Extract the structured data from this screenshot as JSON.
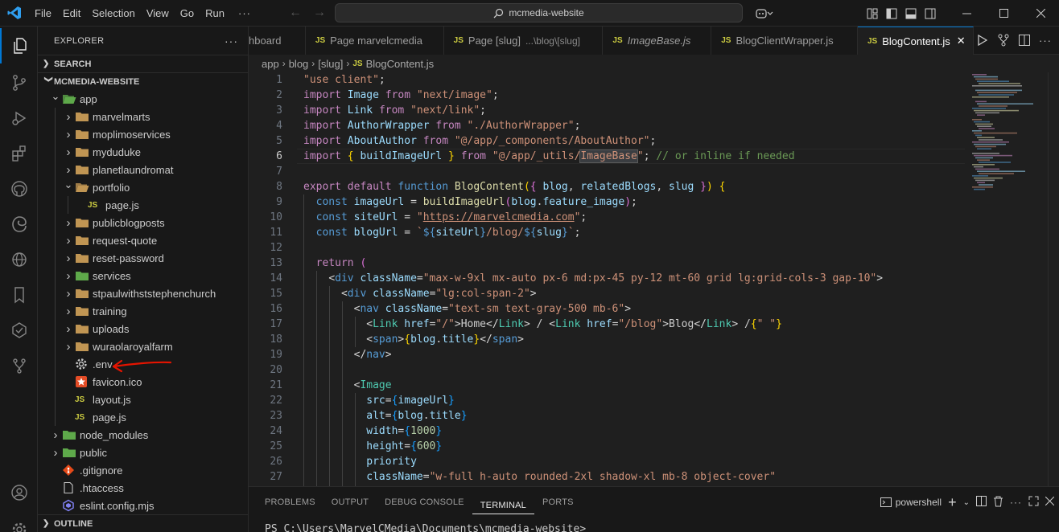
{
  "titlebar": {
    "menu": [
      "File",
      "Edit",
      "Selection",
      "View",
      "Go",
      "Run",
      "···"
    ],
    "search_text": "mcmedia-website"
  },
  "sidebar": {
    "header": "EXPLORER",
    "header_more": "···",
    "search_section": "SEARCH",
    "project_section": "MCMEDIA-WEBSITE",
    "outline_section": "OUTLINE",
    "tree": [
      {
        "label": "app",
        "kind": "folder-special",
        "depth": 1,
        "open": true
      },
      {
        "label": "marvelmarts",
        "kind": "folder",
        "depth": 2
      },
      {
        "label": "moplimoservices",
        "kind": "folder",
        "depth": 2
      },
      {
        "label": "myduduke",
        "kind": "folder",
        "depth": 2
      },
      {
        "label": "planetlaundromat",
        "kind": "folder",
        "depth": 2
      },
      {
        "label": "portfolio",
        "kind": "folder",
        "depth": 2,
        "open": true
      },
      {
        "label": "page.js",
        "kind": "js",
        "depth": 3
      },
      {
        "label": "publicblogposts",
        "kind": "folder",
        "depth": 2
      },
      {
        "label": "request-quote",
        "kind": "folder",
        "depth": 2
      },
      {
        "label": "reset-password",
        "kind": "folder",
        "depth": 2
      },
      {
        "label": "services",
        "kind": "folder-special",
        "depth": 2
      },
      {
        "label": "stpaulwithststephenchurch",
        "kind": "folder",
        "depth": 2
      },
      {
        "label": "training",
        "kind": "folder",
        "depth": 2
      },
      {
        "label": "uploads",
        "kind": "folder",
        "depth": 2
      },
      {
        "label": "wuraolaroyalfarm",
        "kind": "folder",
        "depth": 2
      },
      {
        "label": ".env",
        "kind": "gear",
        "depth": 2
      },
      {
        "label": "favicon.ico",
        "kind": "star",
        "depth": 2
      },
      {
        "label": "layout.js",
        "kind": "js",
        "depth": 2
      },
      {
        "label": "page.js",
        "kind": "js",
        "depth": 2
      },
      {
        "label": "node_modules",
        "kind": "folder-special",
        "depth": 1
      },
      {
        "label": "public",
        "kind": "folder-special",
        "depth": 1
      },
      {
        "label": ".gitignore",
        "kind": "git",
        "depth": 1
      },
      {
        "label": ".htaccess",
        "kind": "file",
        "depth": 1
      },
      {
        "label": "eslint.config.mjs",
        "kind": "eslint",
        "depth": 1
      }
    ]
  },
  "tabs": [
    {
      "label": "hboard",
      "badge": "",
      "italic": false
    },
    {
      "label": "Page marvelcmedia",
      "badge": "JS",
      "italic": false
    },
    {
      "label": "Page [slug]",
      "badge": "JS",
      "desc": "...\\blog\\[slug]",
      "italic": false
    },
    {
      "label": "ImageBase.js",
      "badge": "JS",
      "italic": true
    },
    {
      "label": "BlogClientWrapper.js",
      "badge": "JS",
      "italic": false
    },
    {
      "label": "BlogContent.js",
      "badge": "JS",
      "italic": false,
      "active": true,
      "close": "✕"
    }
  ],
  "breadcrumb": {
    "parts": [
      "app",
      "blog",
      "[slug]"
    ],
    "file_badge": "JS",
    "file": "BlogContent.js"
  },
  "editor": {
    "line_numbers": [
      "1",
      "2",
      "3",
      "4",
      "5",
      "6",
      "7",
      "8",
      "9",
      "10",
      "11",
      "12",
      "13",
      "14",
      "15",
      "16",
      "17",
      "18",
      "19",
      "20",
      "21",
      "22",
      "23",
      "24",
      "25",
      "26",
      "27"
    ],
    "current_line": "6"
  },
  "panel": {
    "tabs": [
      "PROBLEMS",
      "OUTPUT",
      "DEBUG CONSOLE",
      "TERMINAL",
      "PORTS"
    ],
    "active_tab": "TERMINAL",
    "shell": "powershell",
    "terminal_line": "PS C:\\Users\\MarvelCMedia\\Documents\\mcmedia-website>"
  },
  "colors": {
    "accent": "#0078d4",
    "annotation_arrow": "#e51400",
    "js_badge": "#cbcb41"
  }
}
